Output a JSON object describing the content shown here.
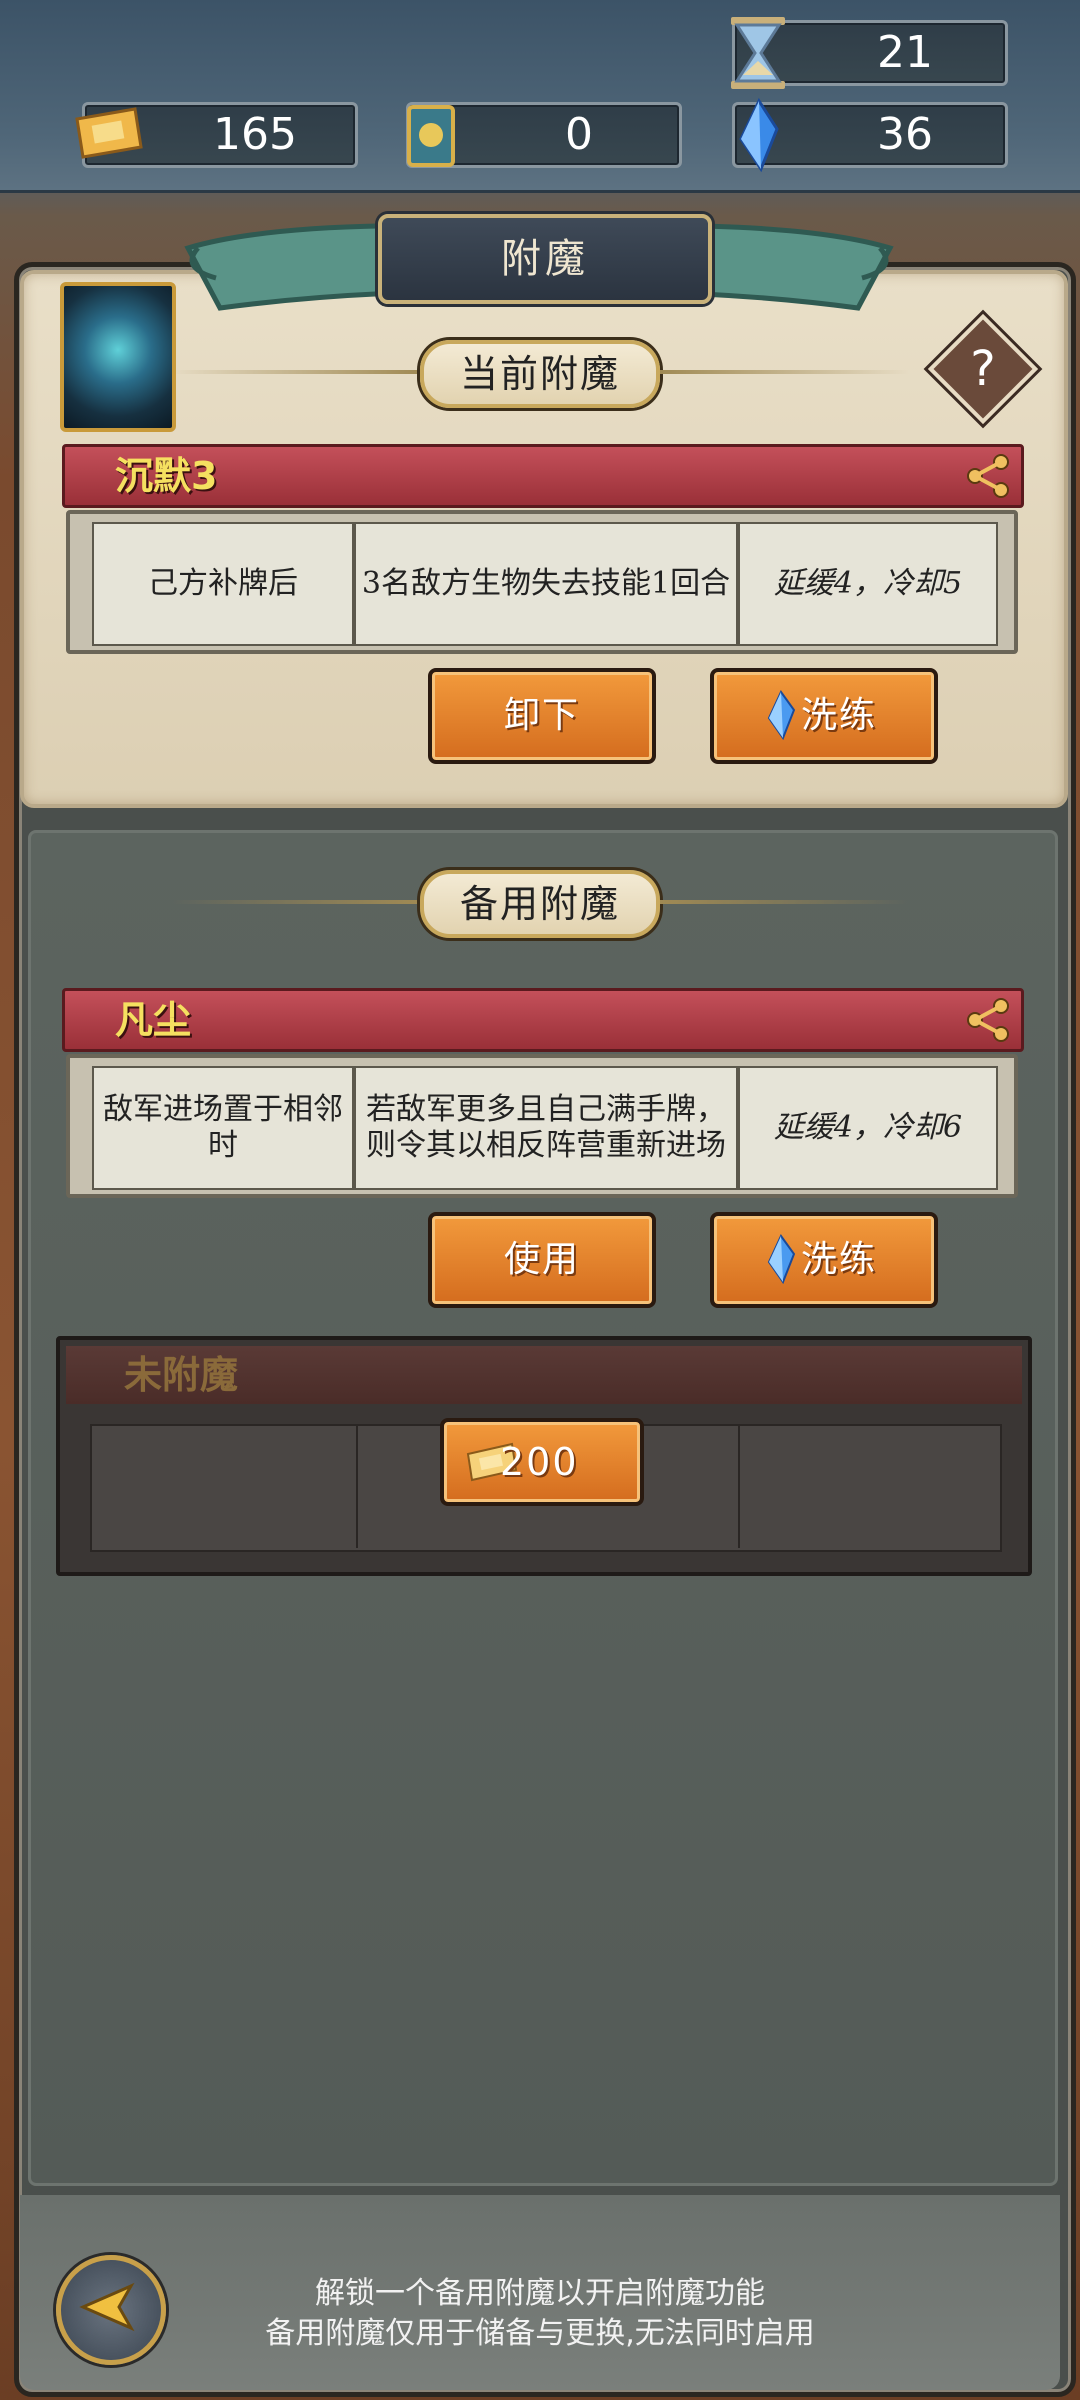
{
  "resources": {
    "hourglass": {
      "icon": "hourglass-icon",
      "value": "21"
    },
    "ticket": {
      "icon": "ticket-icon",
      "value": "165"
    },
    "puzzle": {
      "icon": "puzzle-card-icon",
      "value": "0"
    },
    "gem": {
      "icon": "blue-gem-icon",
      "value": "36"
    }
  },
  "page": {
    "title": "附魔",
    "help": "?"
  },
  "current": {
    "section_title": "当前附魔",
    "enchant": {
      "name": "沉默3",
      "trigger": "己方补牌后",
      "effect": "3名敌方生物失去技能1回合",
      "timing": "延缓4，冷却5"
    },
    "unequip_label": "卸下",
    "reroll_label": "洗练"
  },
  "backup": {
    "section_title": "备用附魔",
    "enchant": {
      "name": "凡尘",
      "trigger": "敌军进场置于相邻时",
      "effect": "若敌军更多且自己满手牌，则令其以相反阵营重新进场",
      "timing": "延缓4，冷却6"
    },
    "use_label": "使用",
    "reroll_label": "洗练"
  },
  "locked": {
    "label": "未附魔",
    "unlock_cost": "200"
  },
  "footer": {
    "tip1": "解锁一个备用附魔以开启附魔功能",
    "tip2": "备用附魔仅用于储备与更换,无法同时启用"
  },
  "colors": {
    "accent_orange": "#e4832c",
    "ribbon_red": "#b0404a",
    "name_yellow": "#f5e060"
  }
}
